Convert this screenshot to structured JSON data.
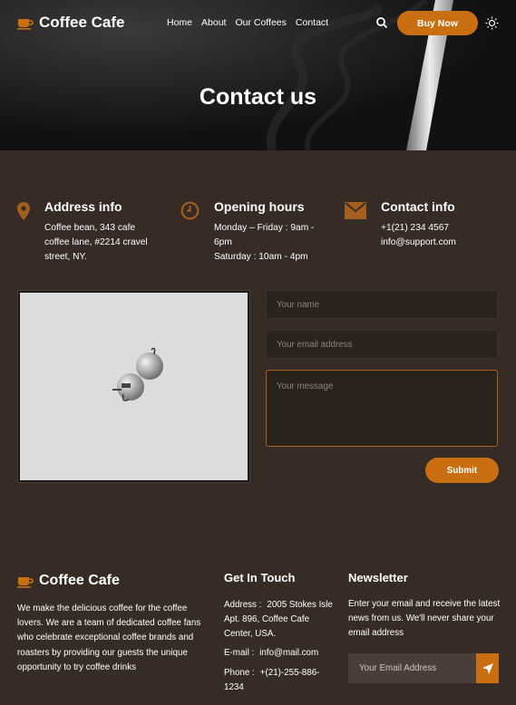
{
  "header": {
    "brand": "Coffee Cafe",
    "nav": [
      "Home",
      "About",
      "Our Coffees",
      "Contact"
    ],
    "buy_now": "Buy Now",
    "page_title": "Contact us"
  },
  "info": {
    "address": {
      "title": "Address info",
      "text": "Coffee bean, 343 cafe\ncoffee lane, #2214 cravel\nstreet, NY."
    },
    "hours": {
      "title": "Opening hours",
      "text": "Monday – Friday : 9am -\n6pm\nSaturday : 10am - 4pm"
    },
    "contact": {
      "title": "Contact info",
      "text": "+1(21) 234 4567\ninfo@support.com"
    }
  },
  "form": {
    "name_placeholder": "Your name",
    "email_placeholder": "Your email address",
    "message_placeholder": "Your message",
    "submit": "Submit"
  },
  "footer": {
    "brand": "Coffee Cafe",
    "about": "We make the delicious coffee for the coffee lovers. We are a team of dedicated coffee fans who celebrate exceptional coffee brands and roasters by providing our guests the unique opportunity to try coffee drinks",
    "get_in_touch": {
      "title": "Get In Touch",
      "address_label": "Address :",
      "address_value": "2005 Stokes Isle Apt. 896, Coffee Cafe Center, USA.",
      "email_label": "E-mail :",
      "email_value": "info@mail.com",
      "phone_label": "Phone :",
      "phone_value": "+(21)-255-886-1234"
    },
    "newsletter": {
      "title": "Newsletter",
      "text": "Enter your email and receive the latest news from us. We'll never share your email address",
      "placeholder": "Your Email Address"
    }
  },
  "colors": {
    "accent": "#c96f12",
    "background": "#372c25",
    "hero": "#141414"
  }
}
